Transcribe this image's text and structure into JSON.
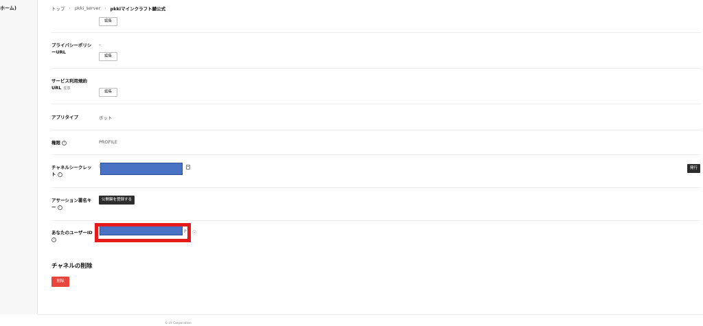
{
  "sidebar": {
    "home_label": "ホーム)"
  },
  "breadcrumb": {
    "items": [
      "トップ",
      "pkki_server",
      "pkkiマインクラフト鯖公式"
    ],
    "separator": "›"
  },
  "fields": {
    "top_edit_label": "編集",
    "privacy": {
      "label_line1": "プライバシーポリシ",
      "label_line2": "ーURL",
      "value": "–",
      "edit_label": "編集"
    },
    "terms": {
      "label_line1": "サービス利用規約",
      "label_line2": "URL",
      "optional": "任意",
      "edit_label": "編集"
    },
    "app_type": {
      "label": "アプリタイプ",
      "value": "ボット"
    },
    "permission": {
      "label": "権限",
      "value": "PROFILE"
    },
    "channel_secret": {
      "label_line1": "チャネルシークレッ",
      "label_line2": "ト",
      "issue_label": "発行"
    },
    "assertion_key": {
      "label_line1": "アサーション署名キ",
      "label_line2": "ー",
      "register_label": "公開鍵を登録する"
    },
    "user_id": {
      "label": "あなたのユーザーID"
    }
  },
  "delete_section": {
    "title": "チャネルの削除",
    "button_label": "削除"
  },
  "footer": {
    "copyright": "© LY Corporation"
  },
  "colors": {
    "redaction": "#4a72c4",
    "highlight": "#e51a1a",
    "danger": "#e8463d",
    "dark_button": "#2d2d2d"
  },
  "icons": [
    "copy-icon",
    "help-icon",
    "chevron-right-icon"
  ]
}
